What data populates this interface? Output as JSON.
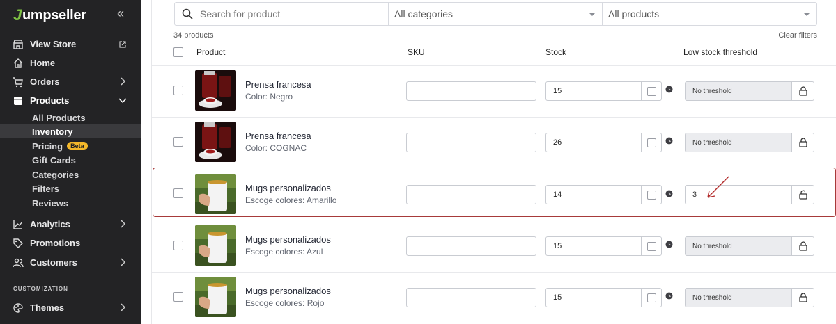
{
  "sidebar": {
    "logo_mark": "J",
    "logo_text": "umpseller",
    "collapse_glyph": "«",
    "view_store": "View Store",
    "home": "Home",
    "orders": "Orders",
    "products": "Products",
    "products_sub": [
      "All Products",
      "Inventory",
      "Pricing",
      "Gift Cards",
      "Categories",
      "Filters",
      "Reviews"
    ],
    "beta_badge": "Beta",
    "analytics": "Analytics",
    "promotions": "Promotions",
    "customers": "Customers",
    "section_customization": "CUSTOMIZATION",
    "themes": "Themes"
  },
  "filters": {
    "search_placeholder": "Search for product",
    "categories": "All categories",
    "products": "All products"
  },
  "summary": {
    "count": "34 products",
    "clear": "Clear filters"
  },
  "table": {
    "headers": {
      "product": "Product",
      "sku": "SKU",
      "stock": "Stock",
      "threshold": "Low stock threshold"
    },
    "rows": [
      {
        "name": "Prensa francesa",
        "variant": "Color: Negro",
        "sku": "",
        "stock": "15",
        "threshold": "No threshold"
      },
      {
        "name": "Prensa francesa",
        "variant": "Color: COGNAC",
        "sku": "",
        "stock": "26",
        "threshold": "No threshold"
      },
      {
        "name": "Mugs personalizados",
        "variant": "Escoge colores: Amarillo",
        "sku": "",
        "stock": "14",
        "threshold": "3"
      },
      {
        "name": "Mugs personalizados",
        "variant": "Escoge colores: Azul",
        "sku": "",
        "stock": "15",
        "threshold": "No threshold"
      },
      {
        "name": "Mugs personalizados",
        "variant": "Escoge colores: Rojo",
        "sku": "",
        "stock": "15",
        "threshold": "No threshold"
      }
    ]
  },
  "colors": {
    "sidebar_bg": "#232325",
    "highlight_border": "#a73a3a",
    "beta_badge": "#f4b82a",
    "logo_accent": "#7ec243"
  }
}
